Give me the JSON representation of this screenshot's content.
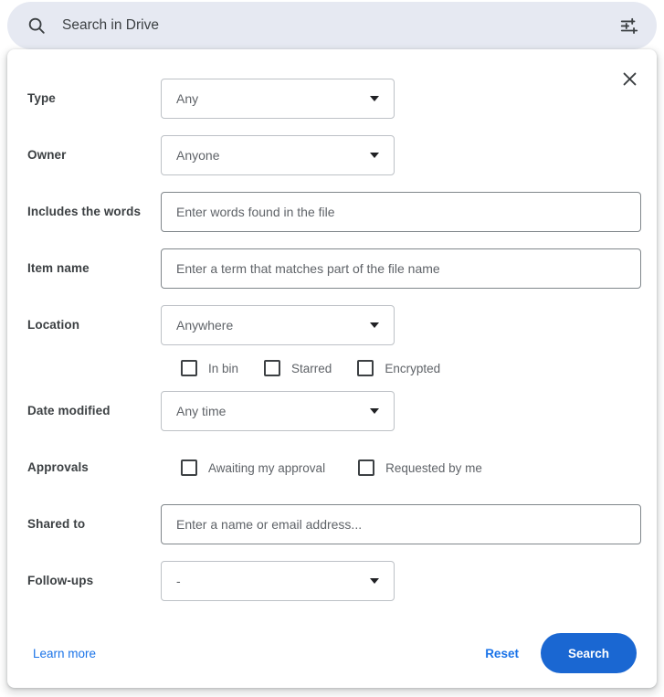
{
  "search": {
    "placeholder": "Search in Drive",
    "value": "",
    "search_icon": "search-icon",
    "tune_icon": "tune-filter-icon"
  },
  "panel": {
    "close_icon": "close-icon",
    "rows": {
      "type": {
        "label": "Type",
        "value": "Any"
      },
      "owner": {
        "label": "Owner",
        "value": "Anyone"
      },
      "includes_words": {
        "label": "Includes the words",
        "placeholder": "Enter words found in the file",
        "value": ""
      },
      "item_name": {
        "label": "Item name",
        "placeholder": "Enter a term that matches part of the file name",
        "value": ""
      },
      "location": {
        "label": "Location",
        "value": "Anywhere",
        "checkboxes": [
          {
            "label": "In bin",
            "checked": false
          },
          {
            "label": "Starred",
            "checked": false
          },
          {
            "label": "Encrypted",
            "checked": false
          }
        ]
      },
      "date_modified": {
        "label": "Date modified",
        "value": "Any time"
      },
      "approvals": {
        "label": "Approvals",
        "checkboxes": [
          {
            "label": "Awaiting my approval",
            "checked": false
          },
          {
            "label": "Requested by me",
            "checked": false
          }
        ]
      },
      "shared_to": {
        "label": "Shared to",
        "placeholder": "Enter a name or email address...",
        "value": ""
      },
      "follow_ups": {
        "label": "Follow-ups",
        "value": "-"
      }
    },
    "footer": {
      "learn_more": "Learn more",
      "reset": "Reset",
      "search": "Search"
    }
  },
  "colors": {
    "searchbar_bg": "#e6e9f2",
    "accent_blue": "#1a73e8",
    "button_blue": "#1a67d2",
    "label_text": "#3c4043",
    "muted_text": "#5f6368",
    "border": "#bdc1c6"
  }
}
